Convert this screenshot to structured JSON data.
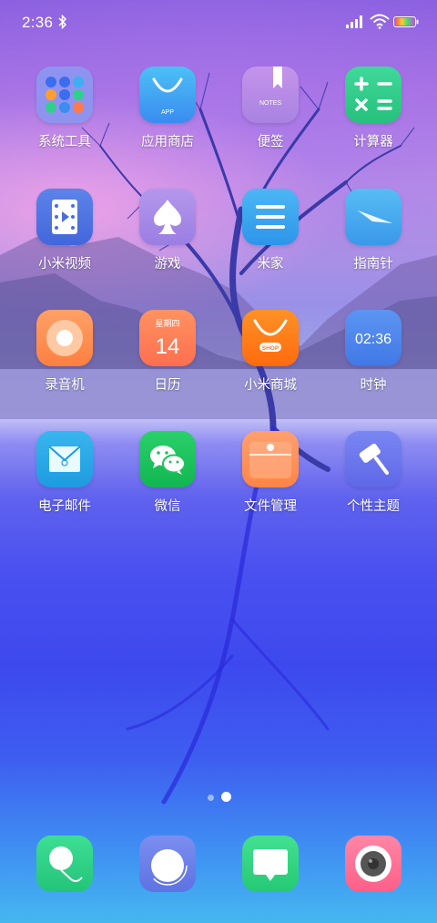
{
  "status_bar": {
    "time": "2:36",
    "icons": [
      "bluetooth-icon",
      "signal-icon",
      "wifi-icon",
      "battery-icon"
    ]
  },
  "apps": [
    {
      "id": "system-tools",
      "label": "系统工具",
      "icon": "folder-icon",
      "color": "#8e8ef0"
    },
    {
      "id": "app-store",
      "label": "应用商店",
      "icon": "shopping-bag-icon",
      "color": "#3aa7f0",
      "icon_text": "APP"
    },
    {
      "id": "notes",
      "label": "便签",
      "icon": "notes-icon",
      "color": "#b18ae6",
      "icon_text": "NOTES"
    },
    {
      "id": "calculator",
      "label": "计算器",
      "icon": "calculator-icon",
      "color": "#2fcf8c"
    },
    {
      "id": "mi-video",
      "label": "小米视频",
      "icon": "video-icon",
      "color": "#4a74e6"
    },
    {
      "id": "games",
      "label": "游戏",
      "icon": "spade-icon",
      "color": "#a486e6"
    },
    {
      "id": "mi-home",
      "label": "米家",
      "icon": "menu-icon",
      "color": "#2fa4ee"
    },
    {
      "id": "compass",
      "label": "指南针",
      "icon": "compass-icon",
      "color": "#43a6ee"
    },
    {
      "id": "recorder",
      "label": "录音机",
      "icon": "record-icon",
      "color": "#ff8e52"
    },
    {
      "id": "calendar",
      "label": "日历",
      "icon": "calendar-icon",
      "color": "#ff7b5a",
      "weekday": "星期四",
      "day": "14"
    },
    {
      "id": "mi-store",
      "label": "小米商城",
      "icon": "shop-bag-icon",
      "color": "#ff7a1a",
      "icon_text": "SHOP"
    },
    {
      "id": "clock",
      "label": "时钟",
      "icon": "clock-icon",
      "color": "#4a86ee",
      "clock_text": "02:36"
    },
    {
      "id": "email",
      "label": "电子邮件",
      "icon": "mail-icon",
      "color": "#2ca8e6"
    },
    {
      "id": "wechat",
      "label": "微信",
      "icon": "wechat-icon",
      "color": "#1fc35c"
    },
    {
      "id": "file-manager",
      "label": "文件管理",
      "icon": "folder-file-icon",
      "color": "#ff8d50"
    },
    {
      "id": "themes",
      "label": "个性主题",
      "icon": "paint-roller-icon",
      "color": "#6b75ee"
    }
  ],
  "dock": [
    {
      "id": "phone",
      "icon": "phone-icon",
      "color": "#2fd088"
    },
    {
      "id": "browser",
      "icon": "browser-icon",
      "color": "#6e80e8"
    },
    {
      "id": "messages",
      "icon": "message-icon",
      "color": "#31d37f"
    },
    {
      "id": "camera",
      "icon": "camera-icon",
      "color": "#ff6f93"
    }
  ],
  "page_indicator": {
    "pages": 2,
    "active": 2
  }
}
